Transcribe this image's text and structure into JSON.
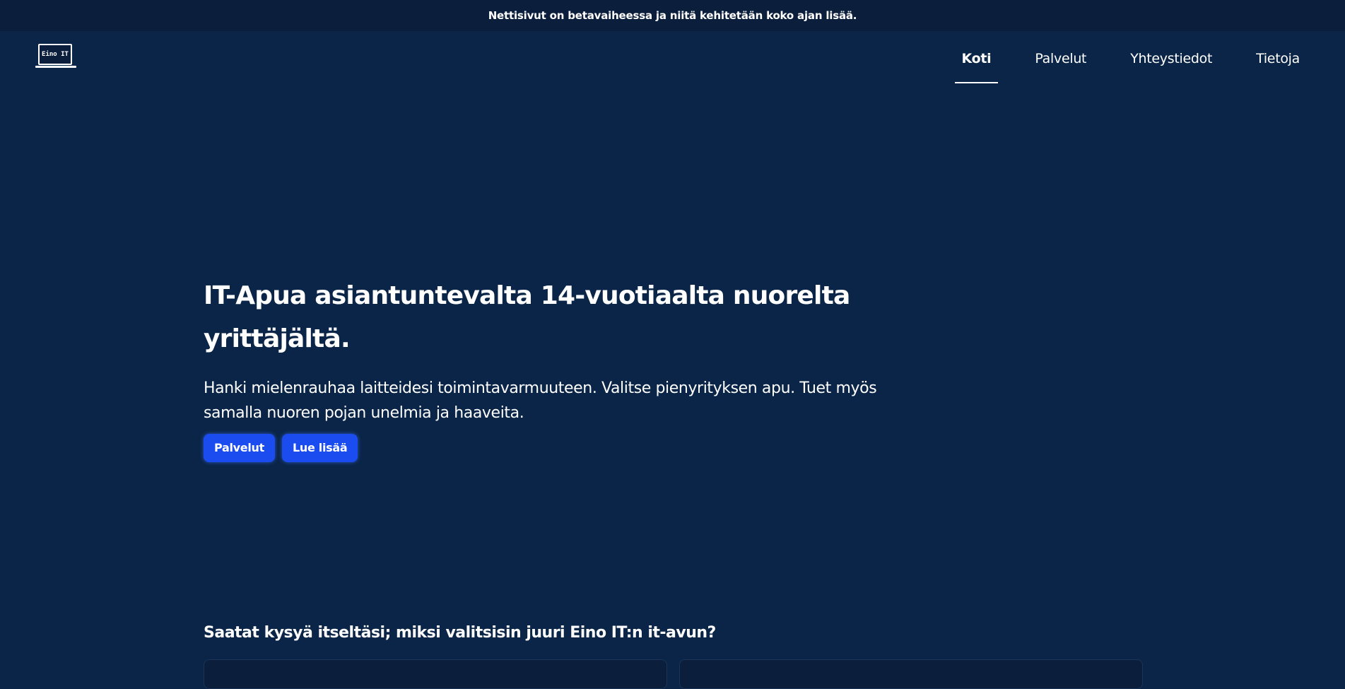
{
  "announcement": {
    "text": "Nettisivut on betavaiheessa ja niitä kehitetään koko ajan lisää."
  },
  "logo": {
    "text": "Eino IT"
  },
  "nav": {
    "items": [
      {
        "label": "Koti",
        "active": true
      },
      {
        "label": "Palvelut",
        "active": false
      },
      {
        "label": "Yhteystiedot",
        "active": false
      },
      {
        "label": "Tietoja",
        "active": false
      }
    ]
  },
  "hero": {
    "title": "IT-Apua asiantuntevalta 14-vuotiaalta nuorelta yrittäjältä.",
    "text": "Hanki mielenrauhaa laitteidesi toimintavarmuuteen. Valitse pienyrityksen apu. Tuet myös samalla nuoren pojan unelmia ja haaveita.",
    "buttons": {
      "services_label": "Palvelut",
      "read_more_label": "Lue lisää"
    }
  },
  "why": {
    "title": "Saatat kysyä itseltäsi; miksi valitsisin juuri Eino IT:n it-avun?"
  },
  "colors": {
    "background": "#0a2547",
    "topbar": "#0b1f3c",
    "button": "#1a4cf0"
  }
}
